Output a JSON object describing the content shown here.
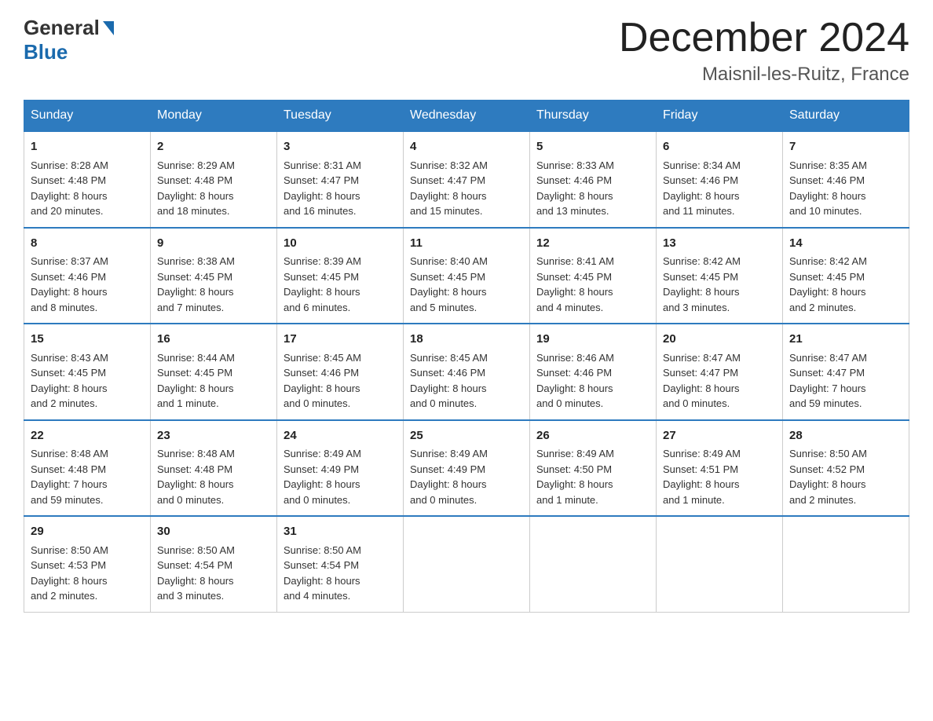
{
  "header": {
    "logo_general": "General",
    "logo_blue": "Blue",
    "month_title": "December 2024",
    "location": "Maisnil-les-Ruitz, France"
  },
  "days_of_week": [
    "Sunday",
    "Monday",
    "Tuesday",
    "Wednesday",
    "Thursday",
    "Friday",
    "Saturday"
  ],
  "weeks": [
    [
      {
        "day": "1",
        "info": "Sunrise: 8:28 AM\nSunset: 4:48 PM\nDaylight: 8 hours\nand 20 minutes."
      },
      {
        "day": "2",
        "info": "Sunrise: 8:29 AM\nSunset: 4:48 PM\nDaylight: 8 hours\nand 18 minutes."
      },
      {
        "day": "3",
        "info": "Sunrise: 8:31 AM\nSunset: 4:47 PM\nDaylight: 8 hours\nand 16 minutes."
      },
      {
        "day": "4",
        "info": "Sunrise: 8:32 AM\nSunset: 4:47 PM\nDaylight: 8 hours\nand 15 minutes."
      },
      {
        "day": "5",
        "info": "Sunrise: 8:33 AM\nSunset: 4:46 PM\nDaylight: 8 hours\nand 13 minutes."
      },
      {
        "day": "6",
        "info": "Sunrise: 8:34 AM\nSunset: 4:46 PM\nDaylight: 8 hours\nand 11 minutes."
      },
      {
        "day": "7",
        "info": "Sunrise: 8:35 AM\nSunset: 4:46 PM\nDaylight: 8 hours\nand 10 minutes."
      }
    ],
    [
      {
        "day": "8",
        "info": "Sunrise: 8:37 AM\nSunset: 4:46 PM\nDaylight: 8 hours\nand 8 minutes."
      },
      {
        "day": "9",
        "info": "Sunrise: 8:38 AM\nSunset: 4:45 PM\nDaylight: 8 hours\nand 7 minutes."
      },
      {
        "day": "10",
        "info": "Sunrise: 8:39 AM\nSunset: 4:45 PM\nDaylight: 8 hours\nand 6 minutes."
      },
      {
        "day": "11",
        "info": "Sunrise: 8:40 AM\nSunset: 4:45 PM\nDaylight: 8 hours\nand 5 minutes."
      },
      {
        "day": "12",
        "info": "Sunrise: 8:41 AM\nSunset: 4:45 PM\nDaylight: 8 hours\nand 4 minutes."
      },
      {
        "day": "13",
        "info": "Sunrise: 8:42 AM\nSunset: 4:45 PM\nDaylight: 8 hours\nand 3 minutes."
      },
      {
        "day": "14",
        "info": "Sunrise: 8:42 AM\nSunset: 4:45 PM\nDaylight: 8 hours\nand 2 minutes."
      }
    ],
    [
      {
        "day": "15",
        "info": "Sunrise: 8:43 AM\nSunset: 4:45 PM\nDaylight: 8 hours\nand 2 minutes."
      },
      {
        "day": "16",
        "info": "Sunrise: 8:44 AM\nSunset: 4:45 PM\nDaylight: 8 hours\nand 1 minute."
      },
      {
        "day": "17",
        "info": "Sunrise: 8:45 AM\nSunset: 4:46 PM\nDaylight: 8 hours\nand 0 minutes."
      },
      {
        "day": "18",
        "info": "Sunrise: 8:45 AM\nSunset: 4:46 PM\nDaylight: 8 hours\nand 0 minutes."
      },
      {
        "day": "19",
        "info": "Sunrise: 8:46 AM\nSunset: 4:46 PM\nDaylight: 8 hours\nand 0 minutes."
      },
      {
        "day": "20",
        "info": "Sunrise: 8:47 AM\nSunset: 4:47 PM\nDaylight: 8 hours\nand 0 minutes."
      },
      {
        "day": "21",
        "info": "Sunrise: 8:47 AM\nSunset: 4:47 PM\nDaylight: 7 hours\nand 59 minutes."
      }
    ],
    [
      {
        "day": "22",
        "info": "Sunrise: 8:48 AM\nSunset: 4:48 PM\nDaylight: 7 hours\nand 59 minutes."
      },
      {
        "day": "23",
        "info": "Sunrise: 8:48 AM\nSunset: 4:48 PM\nDaylight: 8 hours\nand 0 minutes."
      },
      {
        "day": "24",
        "info": "Sunrise: 8:49 AM\nSunset: 4:49 PM\nDaylight: 8 hours\nand 0 minutes."
      },
      {
        "day": "25",
        "info": "Sunrise: 8:49 AM\nSunset: 4:49 PM\nDaylight: 8 hours\nand 0 minutes."
      },
      {
        "day": "26",
        "info": "Sunrise: 8:49 AM\nSunset: 4:50 PM\nDaylight: 8 hours\nand 1 minute."
      },
      {
        "day": "27",
        "info": "Sunrise: 8:49 AM\nSunset: 4:51 PM\nDaylight: 8 hours\nand 1 minute."
      },
      {
        "day": "28",
        "info": "Sunrise: 8:50 AM\nSunset: 4:52 PM\nDaylight: 8 hours\nand 2 minutes."
      }
    ],
    [
      {
        "day": "29",
        "info": "Sunrise: 8:50 AM\nSunset: 4:53 PM\nDaylight: 8 hours\nand 2 minutes."
      },
      {
        "day": "30",
        "info": "Sunrise: 8:50 AM\nSunset: 4:54 PM\nDaylight: 8 hours\nand 3 minutes."
      },
      {
        "day": "31",
        "info": "Sunrise: 8:50 AM\nSunset: 4:54 PM\nDaylight: 8 hours\nand 4 minutes."
      },
      null,
      null,
      null,
      null
    ]
  ]
}
